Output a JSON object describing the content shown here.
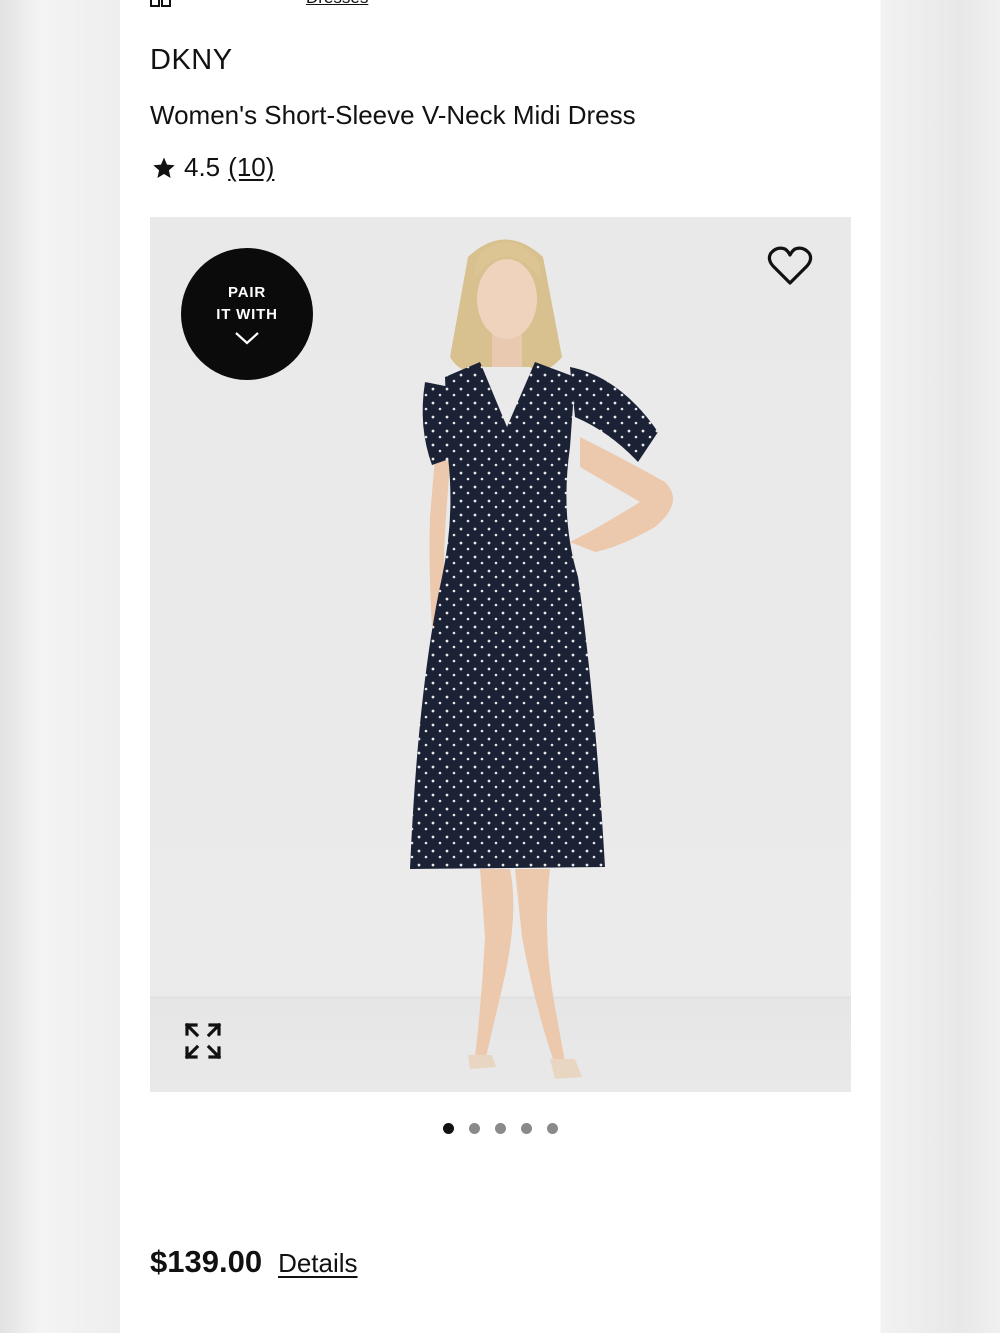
{
  "breadcrumb": {
    "link_label": "Dresses"
  },
  "product": {
    "brand": "DKNY",
    "title": "Women's Short-Sleeve V-Neck Midi Dress",
    "rating": "4.5",
    "review_count": "(10)",
    "price": "$139.00",
    "details_label": "Details"
  },
  "gallery": {
    "badge_line1": "PAIR",
    "badge_line2": "IT WITH",
    "image_count": 5,
    "active_index": 1
  },
  "icons": {
    "favorite": "heart-outline-icon",
    "expand": "expand-arrows-icon",
    "badge": "chevron-down-icon",
    "rating": "star-icon"
  },
  "colors": {
    "badge_bg": "#0b0b0b",
    "gallery_bg": "#e9e9e9",
    "dress": "#1b2236"
  }
}
